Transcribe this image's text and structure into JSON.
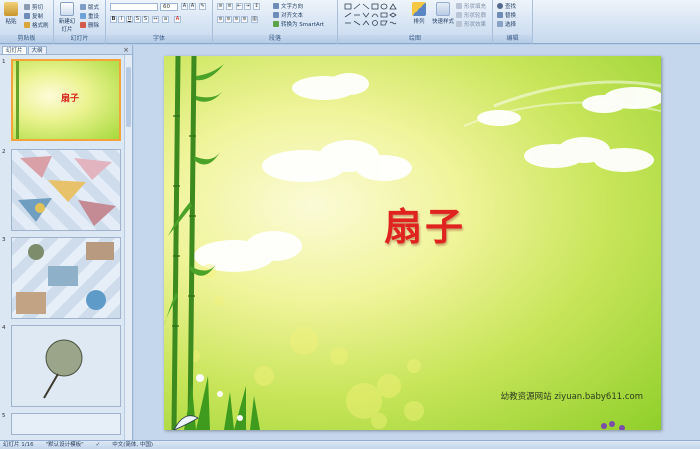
{
  "ribbon": {
    "clipboard": {
      "paste": "粘贴",
      "cut": "剪切",
      "copy": "复制",
      "format_painter": "格式刷",
      "label": "剪贴板"
    },
    "slides": {
      "new_slide": "新建幻灯片",
      "layout": "版式",
      "reset": "重设",
      "delete": "删除",
      "label": "幻灯片"
    },
    "font": {
      "size": "60",
      "label": "字体"
    },
    "paragraph": {
      "text_direction": "文字方向",
      "align_text": "对齐文本",
      "smartart": "转换为 SmartArt",
      "label": "段落"
    },
    "drawing": {
      "arrange": "排列",
      "quick_styles": "快速样式",
      "shape_fill": "形状填充",
      "shape_outline": "形状轮廓",
      "shape_effects": "形状效果",
      "label": "绘图"
    },
    "editing": {
      "find": "查找",
      "replace": "替换",
      "select": "选择",
      "label": "编辑"
    }
  },
  "pane": {
    "tabs": [
      "幻灯片",
      "大纲"
    ],
    "thumbs": [
      {
        "num": "1",
        "title": "扇子"
      },
      {
        "num": "2"
      },
      {
        "num": "3"
      },
      {
        "num": "4"
      },
      {
        "num": "5"
      }
    ]
  },
  "slide": {
    "title": "扇子",
    "footer": "幼教资源网站  ziyuan.baby611.com"
  },
  "status": {
    "slide_num": "幻灯片 1/16",
    "theme": "\"默认设计模板\"",
    "language": "中文(简体, 中国)"
  },
  "colors": {
    "title_red": "#e0231e",
    "ribbon_bg": "#d5e3f3",
    "selection_orange": "#f3a33a"
  }
}
